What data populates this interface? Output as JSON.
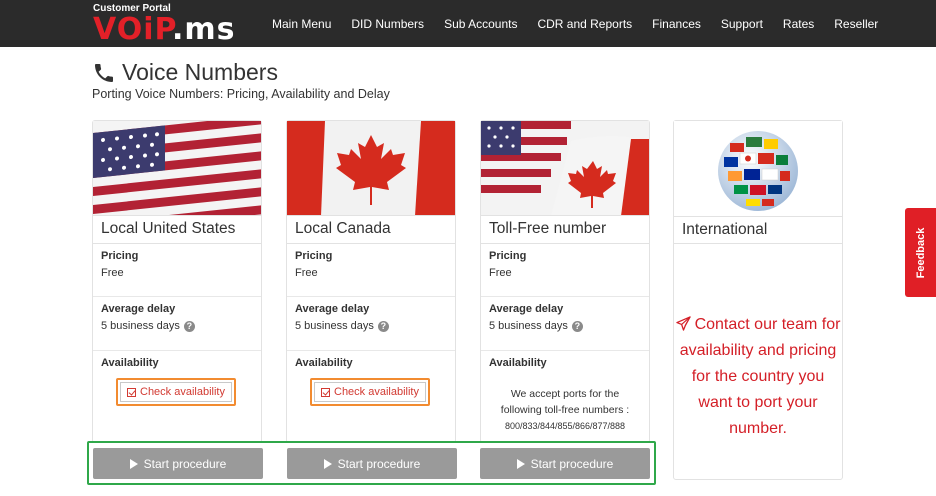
{
  "header": {
    "brand_sub": "Customer Portal",
    "brand_logo_red": "VOiP",
    "brand_logo_white": ".ms",
    "nav": [
      "Main Menu",
      "DID Numbers",
      "Sub Accounts",
      "CDR and Reports",
      "Finances",
      "Support",
      "Rates",
      "Reseller"
    ]
  },
  "page": {
    "title": "Voice Numbers",
    "subtitle": "Porting Voice Numbers: Pricing, Availability and Delay"
  },
  "cards": [
    {
      "title": "Local United States",
      "pricing_label": "Pricing",
      "pricing_value": "Free",
      "delay_label": "Average delay",
      "delay_value": "5 business days",
      "availability_label": "Availability",
      "check_label": "Check availability",
      "start_label": "Start procedure"
    },
    {
      "title": "Local Canada",
      "pricing_label": "Pricing",
      "pricing_value": "Free",
      "delay_label": "Average delay",
      "delay_value": "5 business days",
      "availability_label": "Availability",
      "check_label": "Check availability",
      "start_label": "Start procedure"
    },
    {
      "title": "Toll-Free number",
      "pricing_label": "Pricing",
      "pricing_value": "Free",
      "delay_label": "Average delay",
      "delay_value": "5 business days",
      "availability_label": "Availability",
      "availability_text_1": "We accept ports for the",
      "availability_text_2": "following toll-free numbers :",
      "availability_numbers": "800/833/844/855/866/877/888",
      "start_label": "Start procedure"
    },
    {
      "title": "International",
      "message": "Contact our team for availability and pricing for the country you want to port your number."
    }
  ],
  "feedback": {
    "label": "Feedback"
  },
  "colors": {
    "brand_red": "#e32028",
    "nav_bg": "#2b2b2b",
    "highlight_orange": "#f28b30",
    "highlight_green": "#2fa84a",
    "button_grey": "#9a9a9a"
  },
  "icons": [
    "phone-icon",
    "us-flag-icon",
    "canada-flag-icon",
    "globe-flags-icon",
    "help-icon",
    "checkbox-icon",
    "play-icon",
    "paper-plane-icon"
  ]
}
